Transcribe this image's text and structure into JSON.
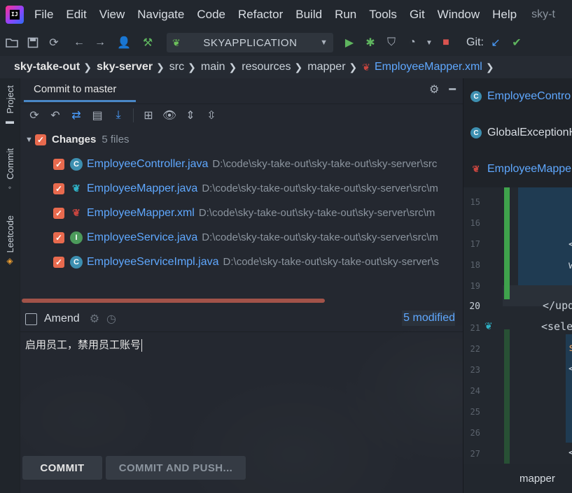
{
  "menubar": {
    "logo_text": "IJ",
    "items": [
      "File",
      "Edit",
      "View",
      "Navigate",
      "Code",
      "Refactor",
      "Build",
      "Run",
      "Tools",
      "Git",
      "Window",
      "Help"
    ],
    "title": "sky-t"
  },
  "toolbar": {
    "run_config": "SKYAPPLICATION",
    "git_label": "Git:"
  },
  "breadcrumb": [
    "sky-take-out",
    "sky-server",
    "src",
    "main",
    "resources",
    "mapper",
    "EmployeeMapper.xml"
  ],
  "left_strip": {
    "tabs": [
      "Project",
      "Commit",
      "Leetcode"
    ]
  },
  "commit_panel": {
    "tab_title": "Commit to master",
    "changes_label": "Changes",
    "changes_count": "5 files",
    "files": [
      {
        "icon": "C",
        "type": "class",
        "name": "EmployeeController.java",
        "path": "D:\\code\\sky-take-out\\sky-take-out\\sky-server\\src"
      },
      {
        "icon": "M",
        "type": "mapper",
        "name": "EmployeeMapper.java",
        "path": "D:\\code\\sky-take-out\\sky-take-out\\sky-server\\src\\m"
      },
      {
        "icon": "M",
        "type": "mapper-xml",
        "name": "EmployeeMapper.xml",
        "path": "D:\\code\\sky-take-out\\sky-take-out\\sky-server\\src\\m"
      },
      {
        "icon": "I",
        "type": "interface",
        "name": "EmployeeService.java",
        "path": "D:\\code\\sky-take-out\\sky-take-out\\sky-server\\src\\m"
      },
      {
        "icon": "C",
        "type": "class",
        "name": "EmployeeServiceImpl.java",
        "path": "D:\\code\\sky-take-out\\sky-take-out\\sky-server\\s"
      }
    ],
    "amend_label": "Amend",
    "modified_label": "5 modified",
    "commit_message": "启用员工，禁用员工账号",
    "commit_button": "COMMIT",
    "commit_push_button": "COMMIT AND PUSH..."
  },
  "editor": {
    "tabs": [
      {
        "name": "EmployeeContro",
        "icon": "C"
      },
      {
        "name": "GlobalExceptionH",
        "icon": "C"
      },
      {
        "name": "EmployeeMappe",
        "icon": "M"
      }
    ],
    "line_numbers": [
      "15",
      "16",
      "17",
      "18",
      "19",
      "20",
      "21",
      "22",
      "23",
      "24",
      "25",
      "26",
      "27"
    ],
    "current_line": "20",
    "code_fragments": {
      "l17": "<",
      "l18": "w",
      "l20": "</upd",
      "l21": "<sele",
      "l22": "s",
      "l23": "<",
      "l27": "<"
    },
    "bottom_tab": "mapper"
  }
}
